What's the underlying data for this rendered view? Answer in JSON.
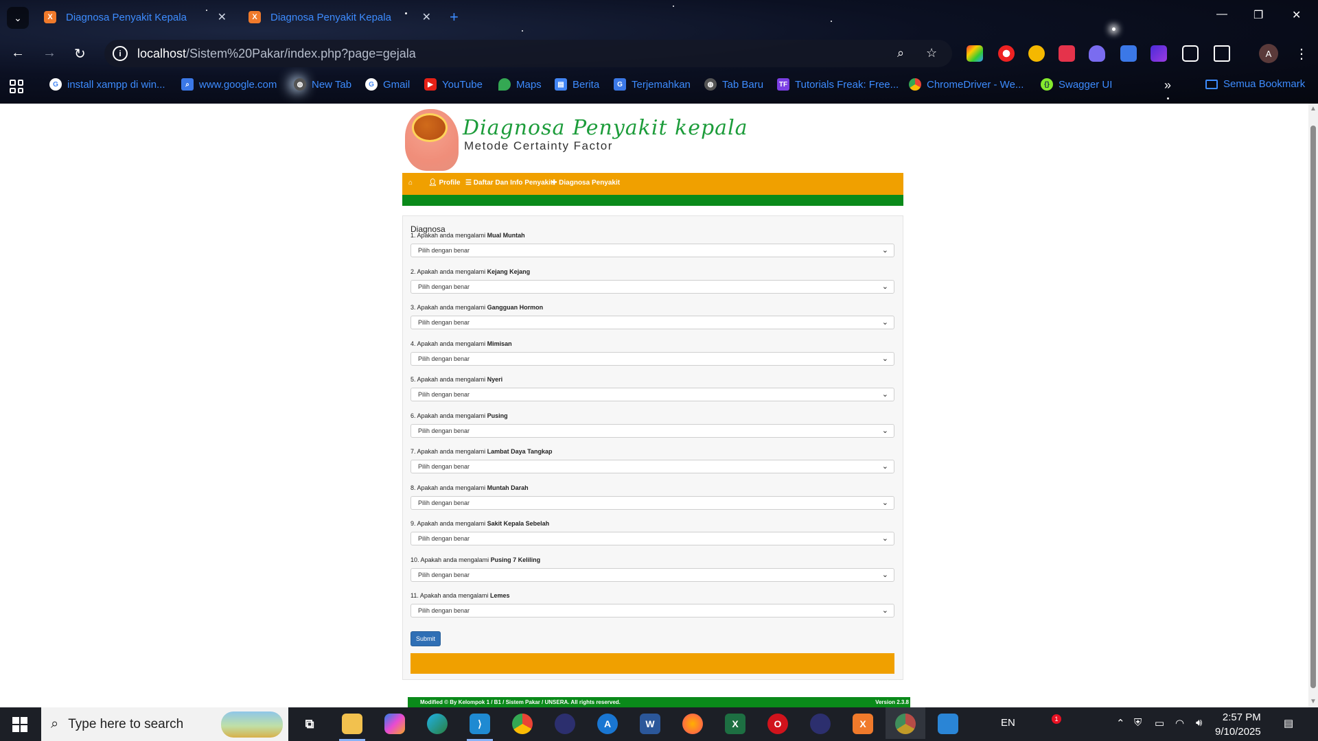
{
  "browser": {
    "tabs": [
      {
        "title": "Diagnosa Penyakit Kepala"
      },
      {
        "title": "Diagnosa Penyakit Kepala"
      }
    ],
    "url_host": "localhost",
    "url_path": "/Sistem%20Pakar/index.php?page=gejala",
    "bookmarks": [
      {
        "label": "install xampp di win...",
        "icon": "google-icon"
      },
      {
        "label": "www.google.com",
        "icon": "search-icon"
      },
      {
        "label": "New Tab",
        "icon": "globe-icon"
      },
      {
        "label": "Gmail",
        "icon": "google-icon"
      },
      {
        "label": "YouTube",
        "icon": "youtube-icon"
      },
      {
        "label": "Maps",
        "icon": "maps-icon"
      },
      {
        "label": "Berita",
        "icon": "news-icon"
      },
      {
        "label": "Terjemahkan",
        "icon": "translate-icon"
      },
      {
        "label": "Tab Baru",
        "icon": "globe-icon"
      },
      {
        "label": "Tutorials Freak: Free...",
        "icon": "tf-icon"
      },
      {
        "label": "ChromeDriver - We...",
        "icon": "chrome-icon"
      },
      {
        "label": "Swagger UI",
        "icon": "swagger-icon"
      }
    ],
    "all_bookmarks": "Semua Bookmark",
    "profile_initial": "A"
  },
  "site": {
    "title": "Diagnosa Penyakit kepala",
    "subtitle": "Metode Certainty Factor",
    "nav": {
      "profile": "Profile",
      "daftar": "Daftar Dan Info Penyakit",
      "diagnosa": "Diagnosa Penyakit"
    },
    "panel_title": "Diagnosa",
    "question_prefix": "Apakah anda mengalami",
    "select_placeholder": "Pilih dengan benar",
    "questions": [
      {
        "num": "1.",
        "symptom": "Mual Muntah"
      },
      {
        "num": "2.",
        "symptom": "Kejang Kejang"
      },
      {
        "num": "3.",
        "symptom": "Gangguan Hormon"
      },
      {
        "num": "4.",
        "symptom": "Mimisan"
      },
      {
        "num": "5.",
        "symptom": "Nyeri"
      },
      {
        "num": "6.",
        "symptom": "Pusing"
      },
      {
        "num": "7.",
        "symptom": "Lambat Daya Tangkap"
      },
      {
        "num": "8.",
        "symptom": "Muntah Darah"
      },
      {
        "num": "9.",
        "symptom": "Sakit Kepala Sebelah"
      },
      {
        "num": "10.",
        "symptom": "Pusing 7 Keliling"
      },
      {
        "num": "11.",
        "symptom": "Lemes"
      }
    ],
    "submit_label": "Submit",
    "footer_left": "Modified © By Kelompok 1 / B1 / Sistem Pakar / UNSERA. All rights reserved.",
    "footer_right": "Version 2.3.8",
    "colors": {
      "orange": "#f0a000",
      "green": "#0a8a1a",
      "button": "#2f6fb5",
      "title": "#1c9c3a"
    }
  },
  "taskbar": {
    "search_placeholder": "Type here to search",
    "language": "EN",
    "notification_count": "1",
    "time": "2:57 PM",
    "date": "9/10/2025"
  }
}
